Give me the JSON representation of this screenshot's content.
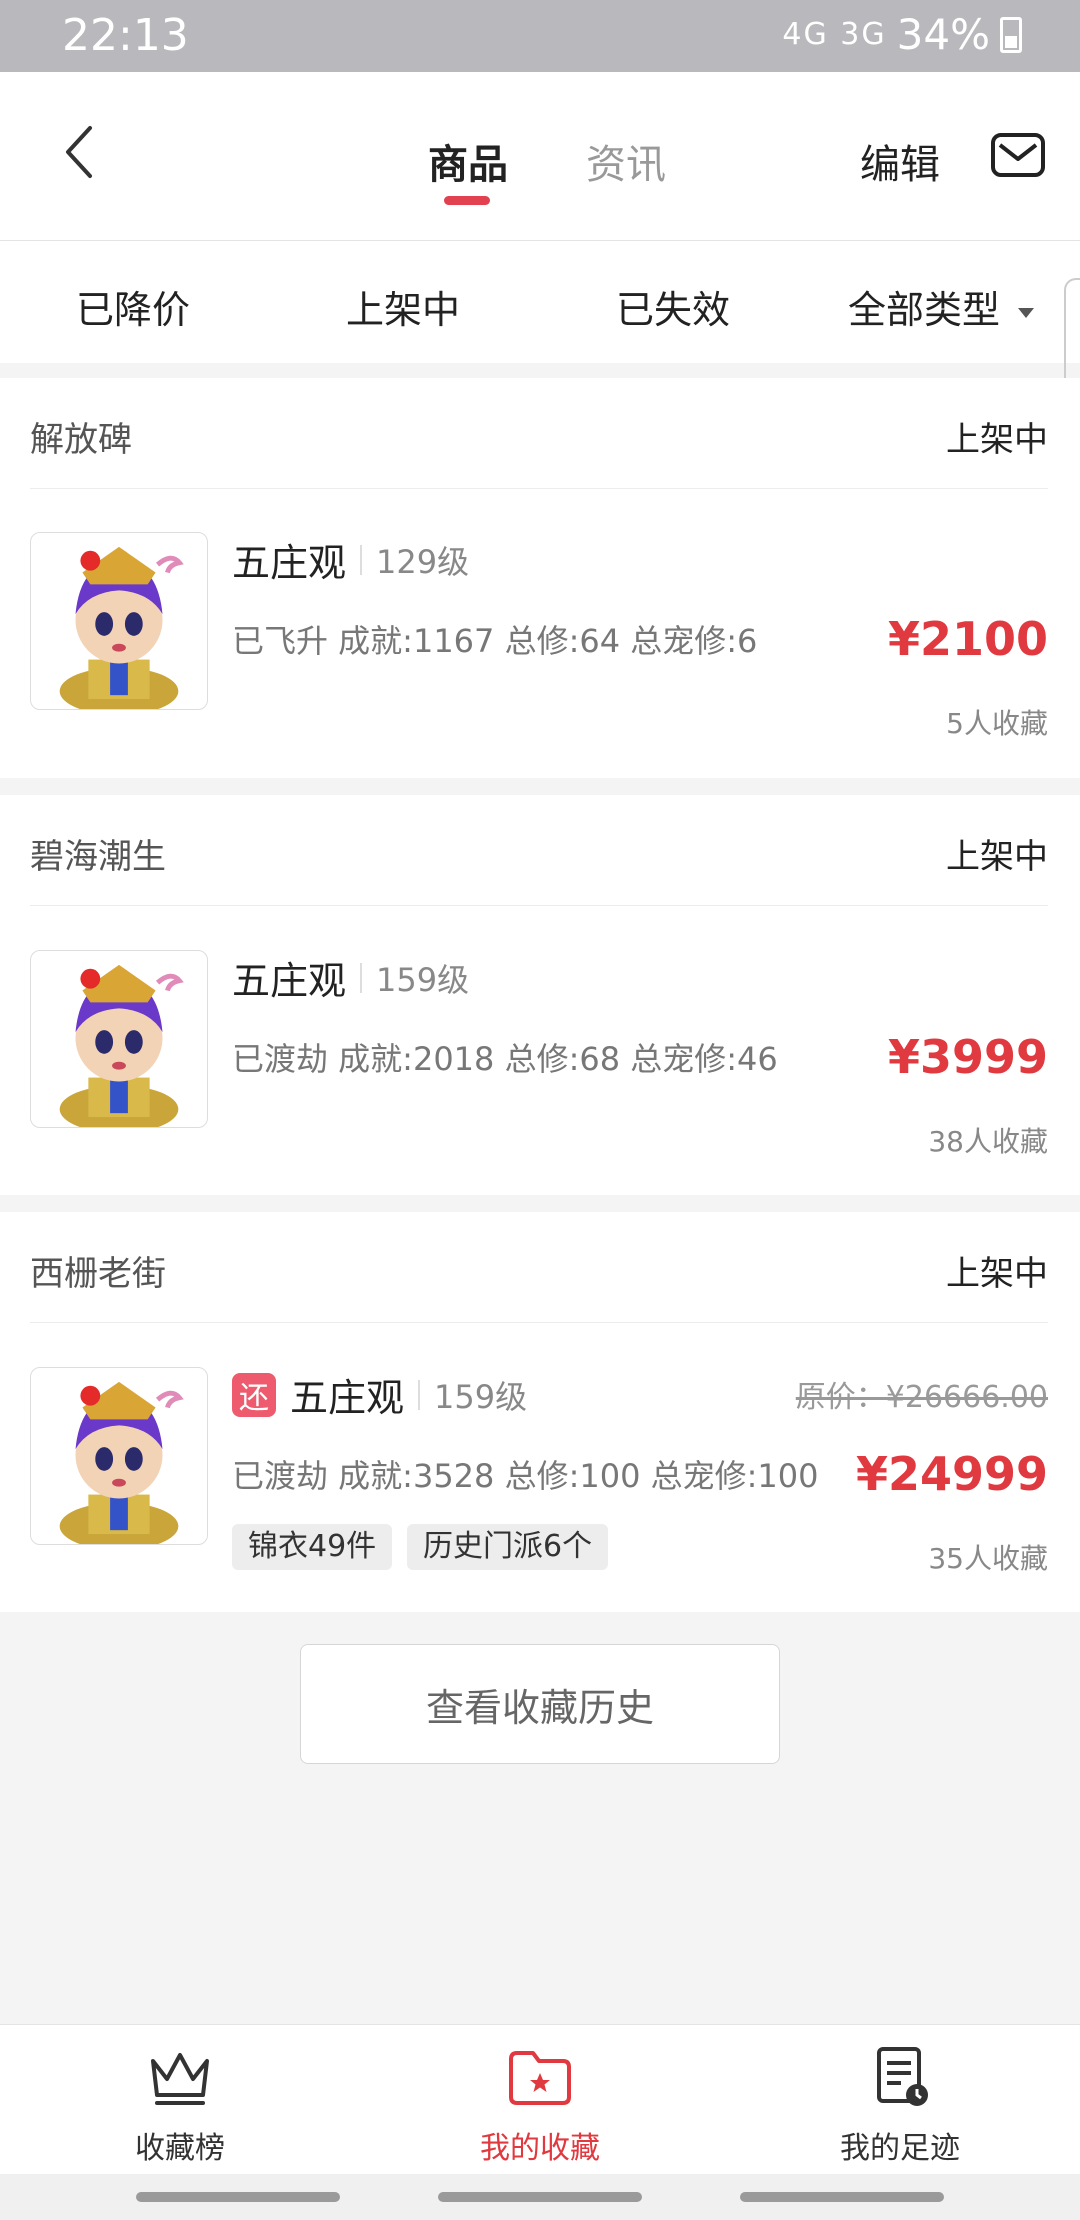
{
  "status_bar": {
    "time": "22:13",
    "network": "4G 3G",
    "battery": "34%"
  },
  "header": {
    "tabs": [
      "商品",
      "资讯"
    ],
    "active_tab": 0,
    "edit_label": "编辑"
  },
  "filters": [
    "已降价",
    "上架中",
    "已失效",
    "全部类型"
  ],
  "items": [
    {
      "seller": "解放碑",
      "status": "上架中",
      "name": "五庄观",
      "level": "129级",
      "description": "已飞升 成就:1167 总修:64 总宠修:6",
      "price": "¥2100",
      "favorites": "5人收藏"
    },
    {
      "seller": "碧海潮生",
      "status": "上架中",
      "name": "五庄观",
      "level": "159级",
      "description": "已渡劫 成就:2018 总修:68 总宠修:46",
      "price": "¥3999",
      "favorites": "38人收藏"
    },
    {
      "seller": "西栅老街",
      "status": "上架中",
      "badge": "还",
      "name": "五庄观",
      "level": "159级",
      "description": "已渡劫 成就:3528 总修:100 总宠修:100",
      "original_price": "原价：¥26666.00",
      "price": "¥24999",
      "favorites": "35人收藏",
      "tags": [
        "锦衣49件",
        "历史门派6个"
      ]
    }
  ],
  "history_button": "查看收藏历史",
  "bottom_nav": [
    {
      "label": "收藏榜",
      "icon": "crown-icon",
      "active": false
    },
    {
      "label": "我的收藏",
      "icon": "star-folder-icon",
      "active": true
    },
    {
      "label": "我的足迹",
      "icon": "history-note-icon",
      "active": false
    }
  ],
  "colors": {
    "accent": "#e0393f",
    "background": "#f4f4f4",
    "status_bar": "#b9b9bd"
  }
}
